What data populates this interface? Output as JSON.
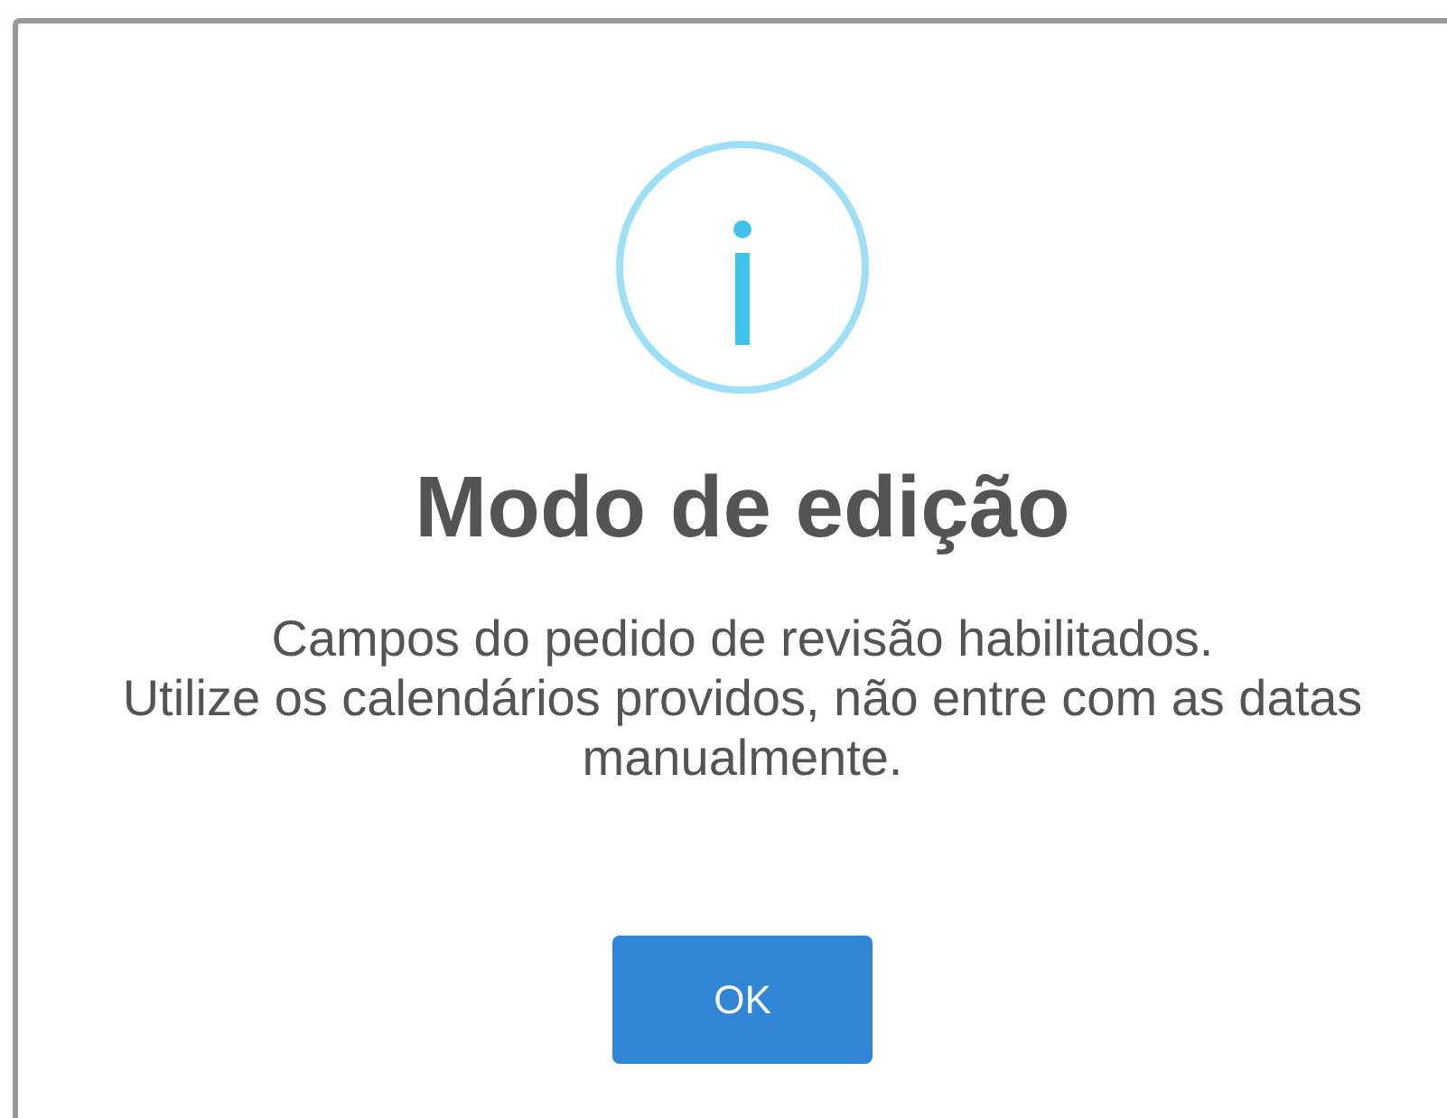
{
  "dialog": {
    "title": "Modo de edição",
    "message_lines": [
      "Campos do pedido de revisão habilitados.",
      "Utilize os calendários providos, não entre com as datas manualmente."
    ],
    "buttons": [
      {
        "label": "OK"
      }
    ]
  }
}
